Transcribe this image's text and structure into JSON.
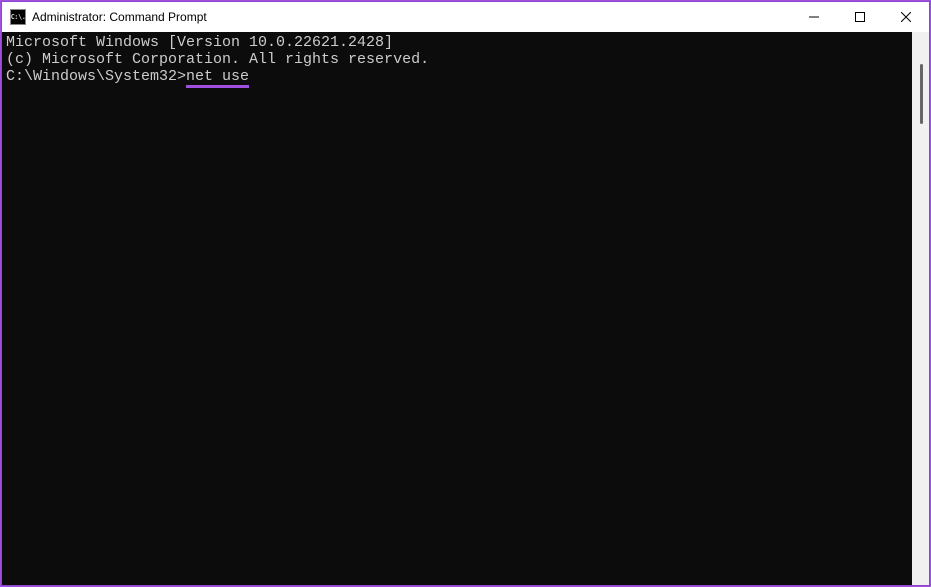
{
  "window": {
    "title": "Administrator: Command Prompt",
    "icon_text": "C:\\."
  },
  "terminal": {
    "line1": "Microsoft Windows [Version 10.0.22621.2428]",
    "line2": "(c) Microsoft Corporation. All rights reserved.",
    "blank": "",
    "prompt": "C:\\Windows\\System32>",
    "command": "net use"
  }
}
